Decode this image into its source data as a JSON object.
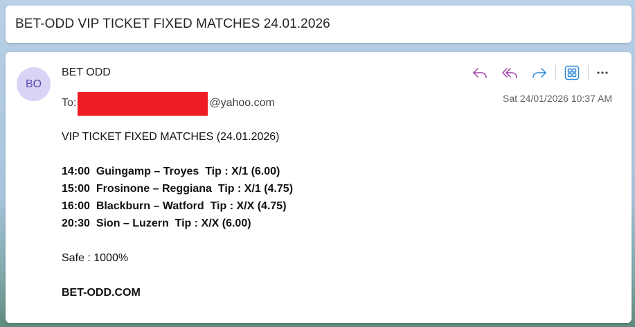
{
  "subject": "BET-ODD VIP TICKET FIXED MATCHES 24.01.2026",
  "sender": {
    "initials": "BO",
    "name": "BET ODD"
  },
  "to": {
    "label": "To:",
    "domain": "@yahoo.com"
  },
  "date": "Sat 24/01/2026 10:37 AM",
  "actions": {
    "reply_icon": "reply-icon",
    "reply_all_icon": "reply-all-icon",
    "forward_icon": "forward-icon",
    "apps_icon": "apps-icon",
    "more_icon": "more-icon",
    "accent_purple": "#a23ea8",
    "accent_blue": "#2b88d8"
  },
  "body": {
    "heading": "VIP TICKET FIXED MATCHES (24.01.2026)",
    "matches": [
      "14:00  Guingamp – Troyes  Tip : X/1 (6.00)",
      "15:00  Frosinone – Reggiana  Tip : X/1 (4.75)",
      "16:00  Blackburn – Watford  Tip : X/X (4.75)",
      "20:30  Sion – Luzern  Tip : X/X (6.00)"
    ],
    "safe": "Safe : 1000%",
    "site": "BET-ODD.COM"
  }
}
